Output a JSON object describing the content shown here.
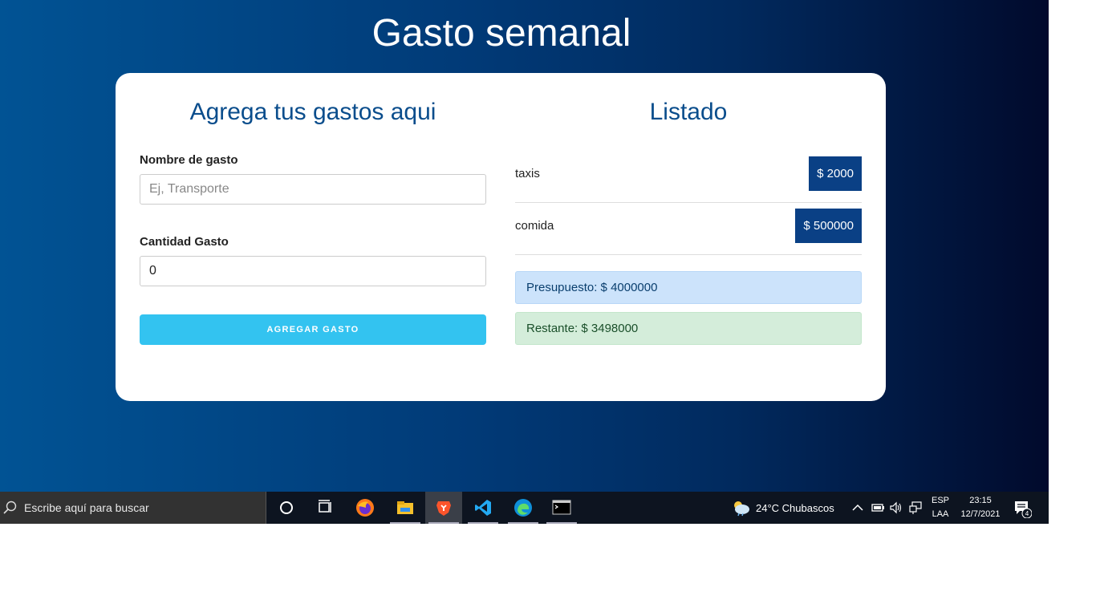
{
  "app": {
    "title": "Gasto semanal",
    "form": {
      "title": "Agrega tus gastos aqui",
      "name_label": "Nombre de gasto",
      "name_placeholder": "Ej, Transporte",
      "name_value": "",
      "amount_label": "Cantidad Gasto",
      "amount_value": "0",
      "submit_label": "AGREGAR GASTO"
    },
    "list": {
      "title": "Listado",
      "items": [
        {
          "name": "taxis",
          "amount": "$ 2000"
        },
        {
          "name": "comida",
          "amount": "$ 500000"
        }
      ],
      "budget": "Presupuesto: $ 4000000",
      "remaining": "Restante: $ 3498000"
    },
    "colors": {
      "accent_blue": "#0a4d8c",
      "badge_bg": "#0a4085",
      "button_bg": "#33c3f0"
    }
  },
  "taskbar": {
    "search_placeholder": "Escribe aquí para buscar",
    "pinned_icons": [
      "cortana-circle-icon",
      "task-view-icon",
      "firefox-icon",
      "file-explorer-icon",
      "brave-icon",
      "vscode-icon",
      "edge-icon",
      "terminal-icon"
    ],
    "weather": "24°C  Chubascos",
    "language": "ESP",
    "layout": "LAA",
    "time": "23:15",
    "date": "12/7/2021",
    "notifications": "4"
  }
}
